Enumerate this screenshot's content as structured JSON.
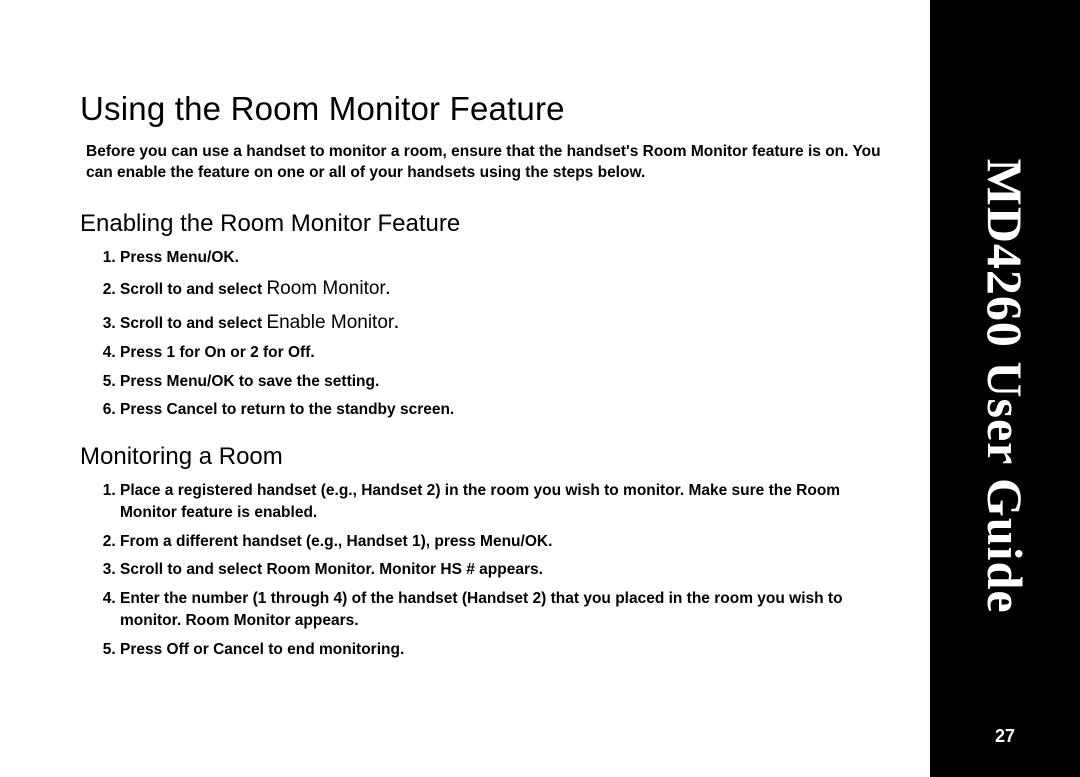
{
  "sidebar": {
    "title": "MD4260 User Guide",
    "page_number": "27"
  },
  "main": {
    "heading": "Using the Room Monitor Feature",
    "intro_parts": {
      "p1": "Before you can use a handset to monitor a room, ensure that the handset's ",
      "p2": "Room Monitor",
      "p3": " feature is on. You can enable the feature on one or all of your handsets using the steps below."
    },
    "section1": {
      "heading": "Enabling the Room Monitor Feature",
      "steps": [
        {
          "parts": [
            "Press ",
            "Menu/OK",
            "."
          ]
        },
        {
          "parts": [
            "Scroll to and select ",
            "Room Monitor",
            "."
          ],
          "ui": [
            1
          ]
        },
        {
          "parts": [
            "Scroll to and select ",
            "Enable Monitor",
            "."
          ],
          "ui": [
            1
          ]
        },
        {
          "parts": [
            "Press 1 for ",
            "On",
            " or 2 for ",
            "Off",
            "."
          ]
        },
        {
          "parts": [
            "Press ",
            "Menu/OK",
            " to save the setting."
          ]
        },
        {
          "parts": [
            "Press ",
            "Cancel",
            " to return to the standby screen."
          ]
        }
      ]
    },
    "section2": {
      "heading": "Monitoring a Room",
      "steps": [
        {
          "parts": [
            "Place a registered handset (e.g., ",
            "Handset 2",
            ") in the room you wish to monitor. Make sure the Room Monitor feature is enabled."
          ]
        },
        {
          "parts": [
            "From a different handset (e.g., ",
            "Handset 1",
            "), press ",
            "Menu/OK",
            "."
          ]
        },
        {
          "parts": [
            "Scroll to and select ",
            "Room Monitor",
            ". ",
            "Monitor HS #",
            " appears."
          ]
        },
        {
          "parts": [
            "Enter the number (1 through 4) of the handset (",
            "Handset 2",
            ") that you placed in the room you wish to monitor. ",
            "Room Monitor",
            " appears."
          ]
        },
        {
          "parts": [
            "Press ",
            "Off",
            " or ",
            "Cancel",
            " to end monitoring."
          ]
        }
      ]
    }
  }
}
